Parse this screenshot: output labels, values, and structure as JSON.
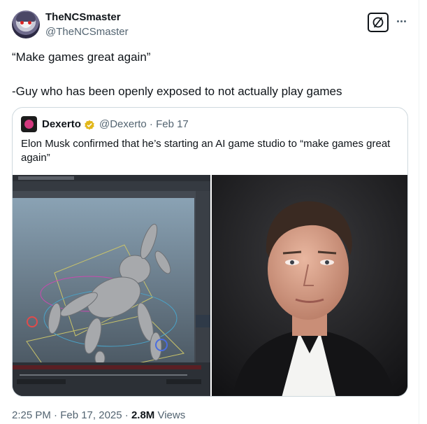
{
  "author": {
    "name": "TheNCSmaster",
    "handle": "@TheNCSmaster"
  },
  "tweet": {
    "line1": "“Make games great again”",
    "line2": "-Guy who has been openly exposed to not actually play games"
  },
  "quoted": {
    "name": "Dexerto",
    "meta": "@Dexerto · Feb 17",
    "text": "Elon Musk confirmed that he’s starting an AI game studio to “make games great again”",
    "verified_color": "#e2b719"
  },
  "footer": {
    "time": "2:25 PM · Feb 17, 2025 · ",
    "views_count": "2.8M",
    "views_label": " Views"
  },
  "icons": {
    "grok": "grok-icon",
    "more": "more-icon",
    "verified": "verified-badge-icon"
  }
}
